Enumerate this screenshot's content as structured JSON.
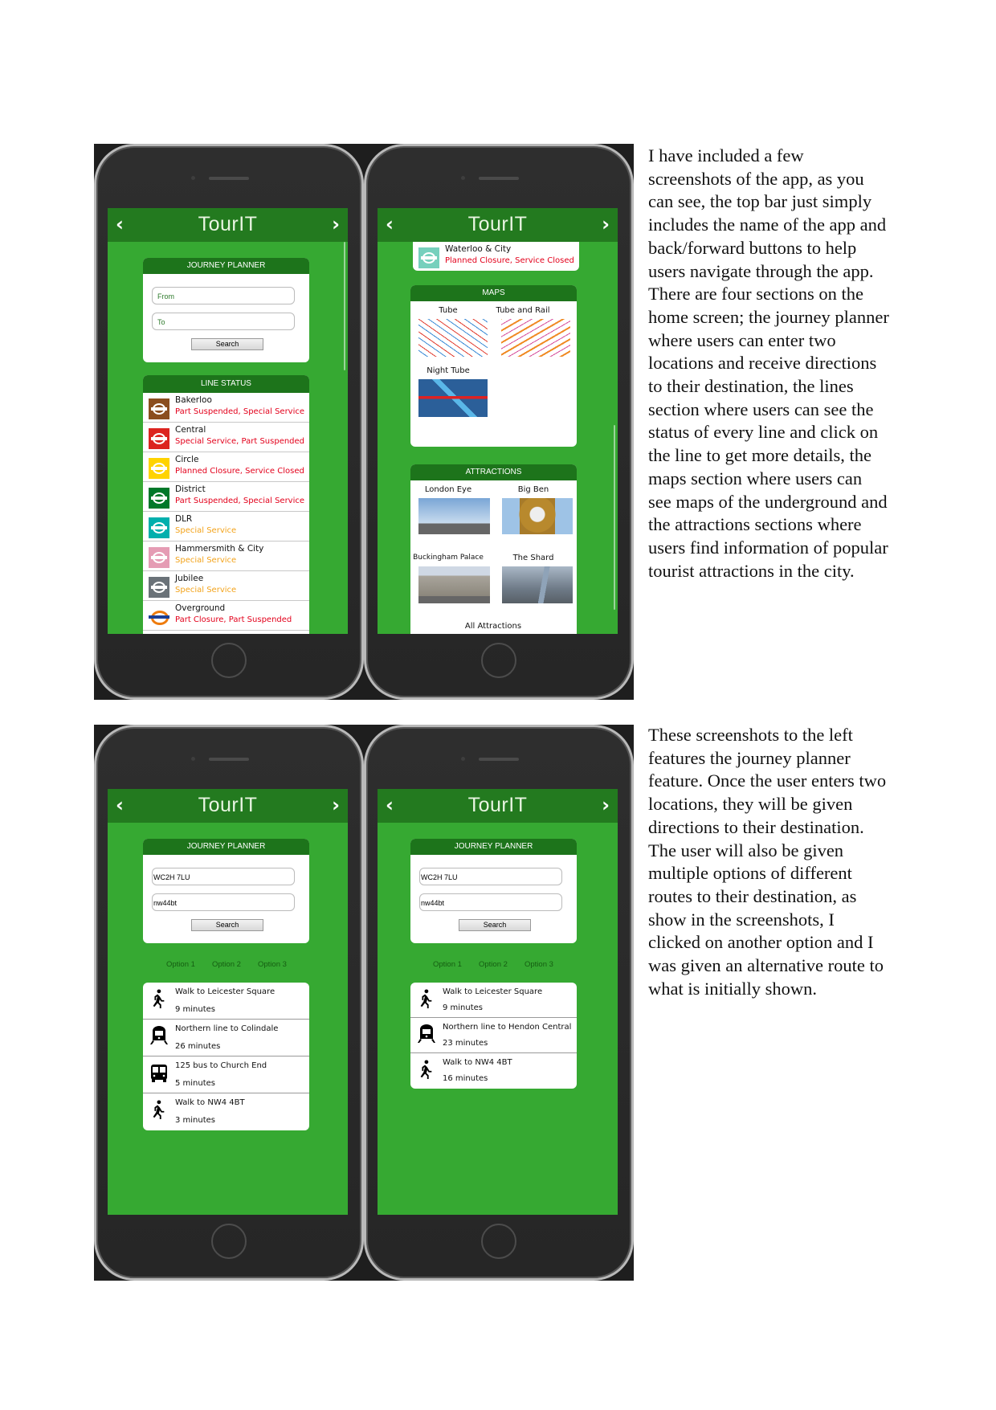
{
  "app": {
    "title": "TourIT",
    "back_icon": "chevron-left-icon",
    "forward_icon": "chevron-right-icon"
  },
  "colors": {
    "screen_bg": "#36a932",
    "header_bg": "#237a1f",
    "card_header_bg": "#1d741b",
    "status_red": "#e3001b",
    "status_orange": "#f3a31b"
  },
  "journey_planner": {
    "title": "JOURNEY PLANNER",
    "from_placeholder": "From",
    "to_placeholder": "To",
    "search_label": "Search"
  },
  "line_status": {
    "title": "LINE STATUS",
    "lines": [
      {
        "name": "Bakerloo",
        "status": "Part Suspended, Special Service",
        "severity": "red",
        "color": "#8b4e1e"
      },
      {
        "name": "Central",
        "status": "Special Service, Part Suspended",
        "severity": "red",
        "color": "#dc241f"
      },
      {
        "name": "Circle",
        "status": "Planned Closure, Service Closed",
        "severity": "red",
        "color": "#ffd300"
      },
      {
        "name": "District",
        "status": "Part Suspended, Special Service",
        "severity": "red",
        "color": "#00782a"
      },
      {
        "name": "DLR",
        "status": "Special Service",
        "severity": "orange",
        "color": "#00afad"
      },
      {
        "name": "Hammersmith & City",
        "status": "Special Service",
        "severity": "orange",
        "color": "#e59cb4"
      },
      {
        "name": "Jubilee",
        "status": "Special Service",
        "severity": "orange",
        "color": "#6a7278"
      },
      {
        "name": "Overground",
        "status": "Part Closure, Part Suspended",
        "severity": "red",
        "color": "#ee7c0e"
      }
    ],
    "waterloo": {
      "name": "Waterloo & City",
      "status": "Planned Closure, Service Closed",
      "severity": "red",
      "color": "#76d0bd"
    }
  },
  "maps": {
    "title": "MAPS",
    "items": [
      "Tube",
      "Tube and Rail",
      "Night Tube"
    ]
  },
  "attractions": {
    "title": "ATTRACTIONS",
    "items": [
      "London Eye",
      "Big Ben",
      "Buckingham Palace",
      "The Shard"
    ],
    "all_label": "All Attractions"
  },
  "journey_results": {
    "from_value": "WC2H 7LU",
    "to_value": "nw44bt",
    "options": [
      "Option 1",
      "Option 2",
      "Option 3"
    ],
    "route_a": [
      {
        "icon": "walk-icon",
        "title": "Walk to Leicester Square",
        "duration": "9 minutes"
      },
      {
        "icon": "train-icon",
        "title": "Northern line to Colindale",
        "duration": "26 minutes"
      },
      {
        "icon": "bus-icon",
        "title": "125 bus to Church End",
        "duration": "5 minutes"
      },
      {
        "icon": "walk-icon",
        "title": "Walk to NW4 4BT",
        "duration": "3 minutes"
      }
    ],
    "route_b": [
      {
        "icon": "walk-icon",
        "title": "Walk to Leicester Square",
        "duration": "9 minutes"
      },
      {
        "icon": "train-icon",
        "title": "Northern line to Hendon Central",
        "duration": "23 minutes"
      },
      {
        "icon": "walk-icon",
        "title": "Walk to NW4 4BT",
        "duration": "16 minutes"
      }
    ]
  },
  "text": {
    "paragraph_1": "I have included a few screenshots of the app, as you can see, the top bar just simply includes the name of the app and back/forward buttons to help users navigate through the app. There are four sections on the home screen; the journey planner where users can enter two locations and receive directions to their destination, the lines section where users can see the status of every line and click on the line to get more details, the maps section where users can see maps of the underground and the attractions sections where users find information of popular tourist attractions in the city.",
    "paragraph_2": "These screenshots to the left features the journey planner feature. Once the user enters two locations, they will be given directions to their destination. The user will also be given multiple options of different routes to their destination, as show in the screenshots, I clicked on another option and I was given an alternative route to what is initially shown."
  }
}
